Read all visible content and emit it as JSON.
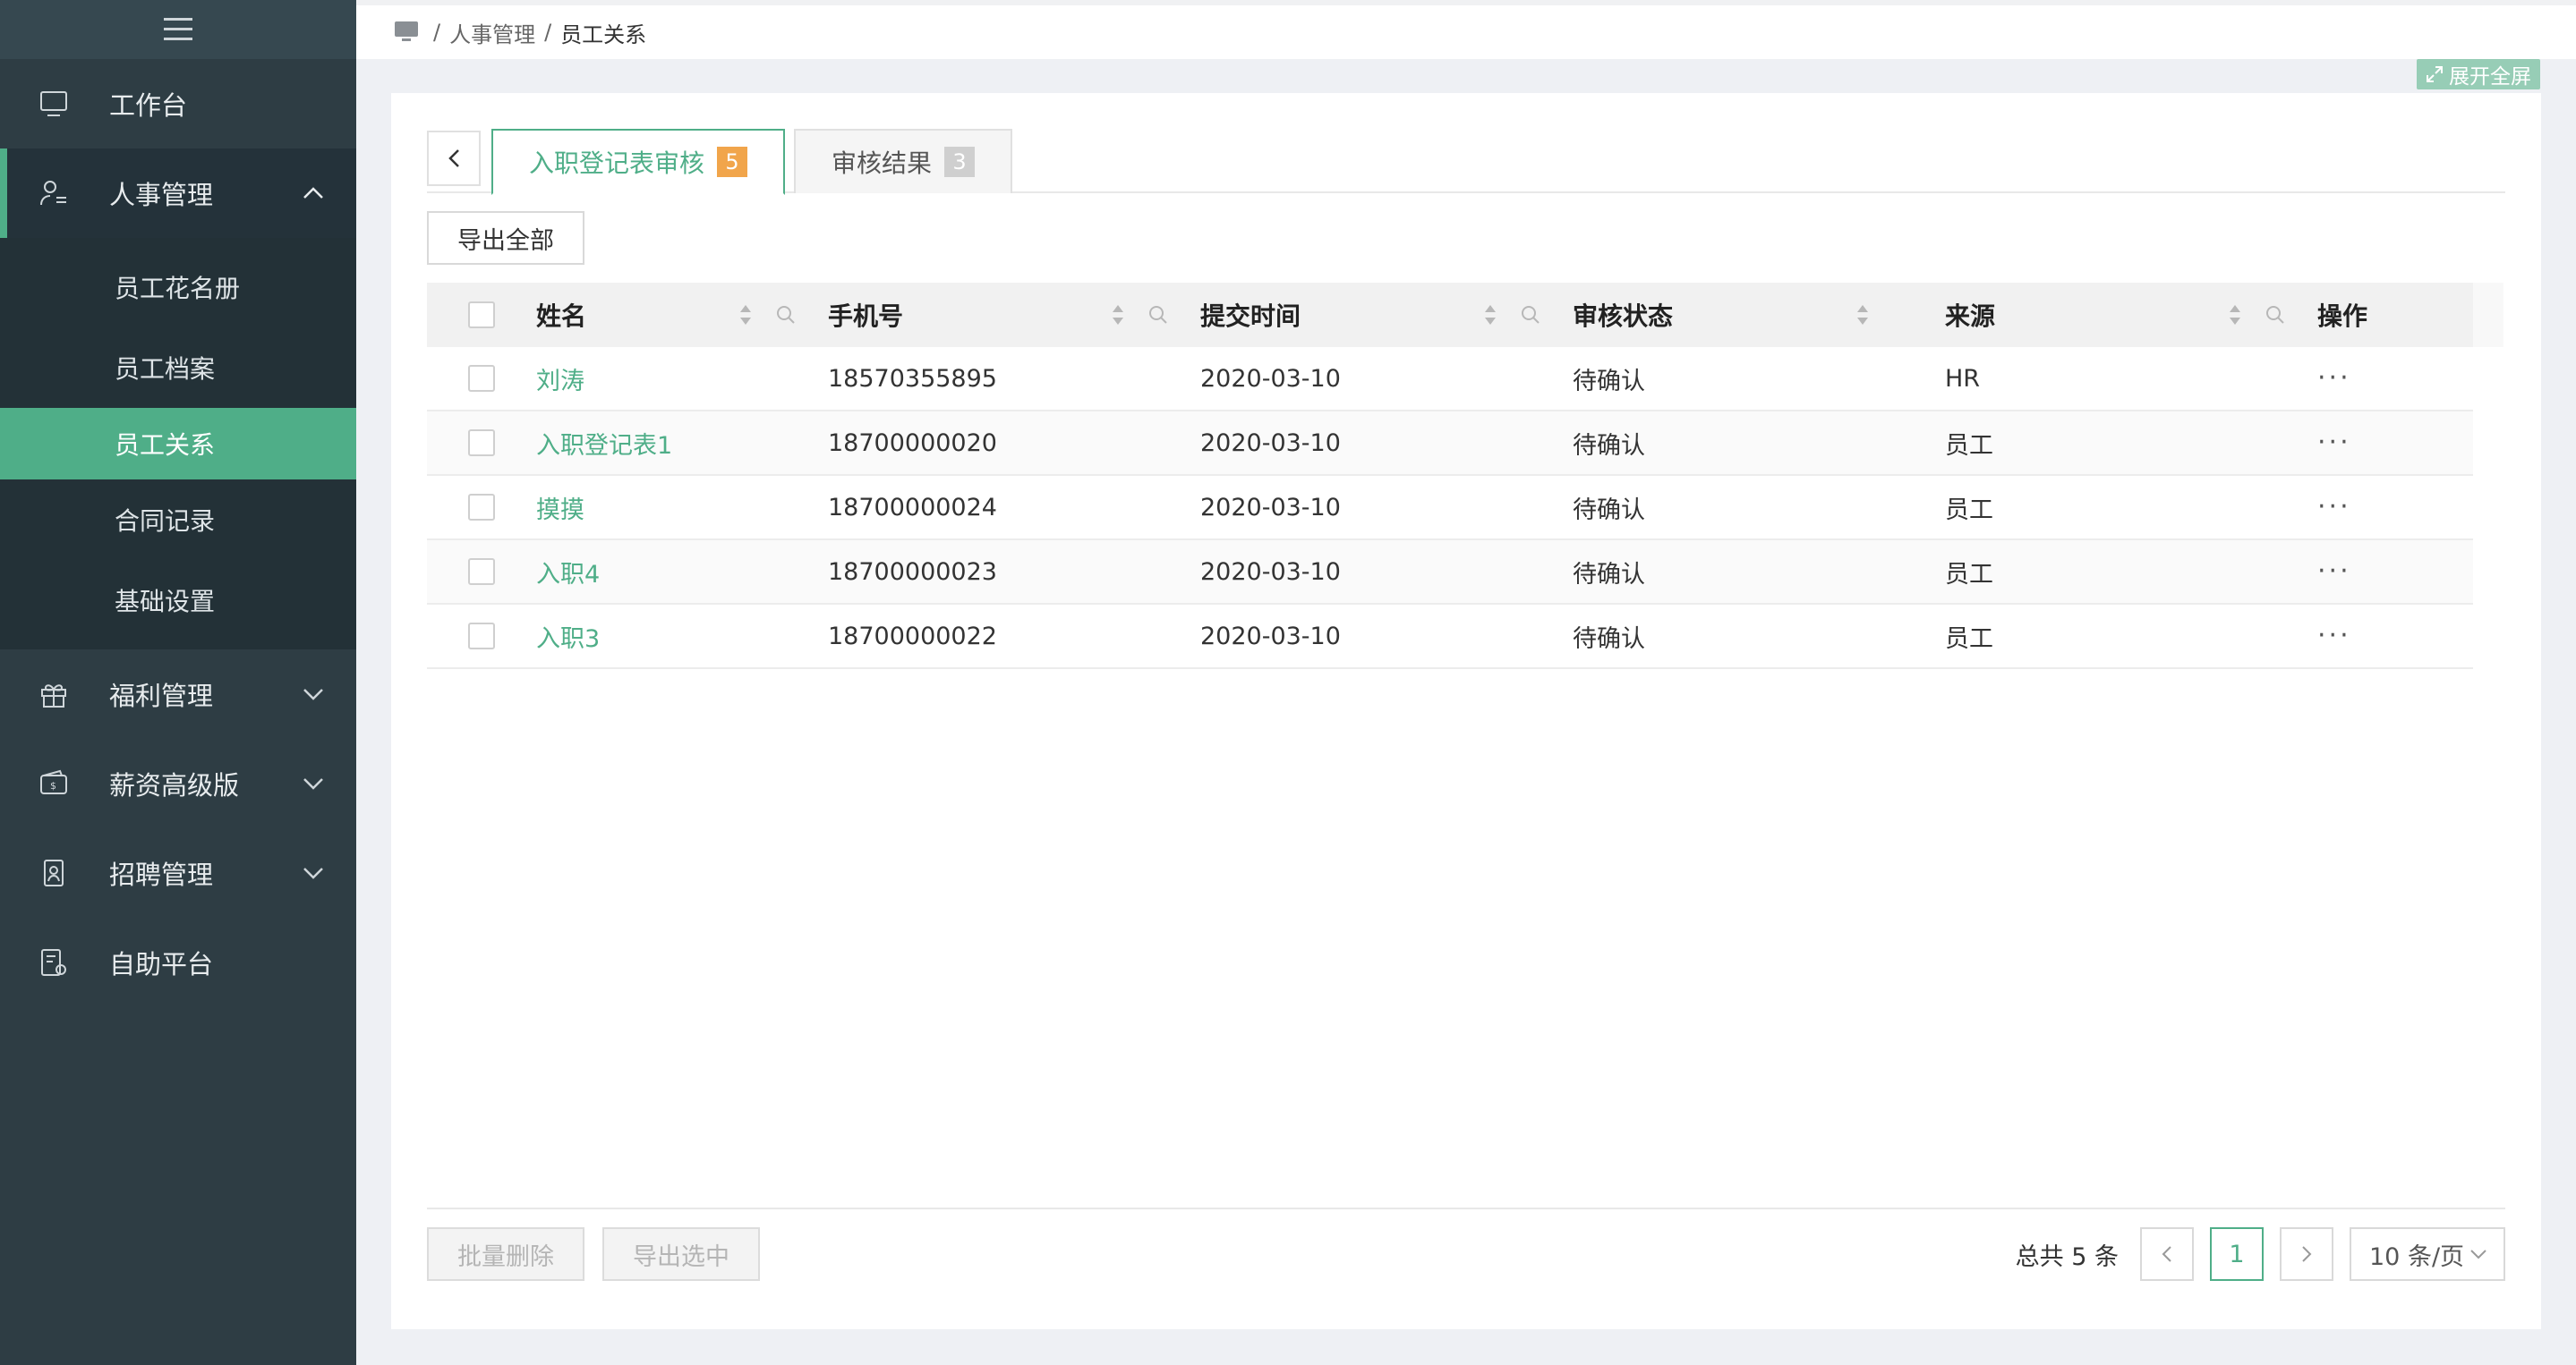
{
  "sidebar": {
    "items": [
      {
        "label": "工作台",
        "icon": "monitor-icon"
      },
      {
        "label": "人事管理",
        "icon": "user-list-icon",
        "expanded": true,
        "children": [
          "员工花名册",
          "员工档案",
          "员工关系",
          "合同记录",
          "基础设置"
        ],
        "active_child": "员工关系"
      },
      {
        "label": "福利管理",
        "icon": "gift-icon"
      },
      {
        "label": "薪资高级版",
        "icon": "wallet-icon"
      },
      {
        "label": "招聘管理",
        "icon": "badge-icon"
      },
      {
        "label": "自助平台",
        "icon": "self-service-icon"
      }
    ]
  },
  "breadcrumb": {
    "sep": "/",
    "items": [
      "人事管理",
      "员工关系"
    ]
  },
  "fullscreen_label": "展开全屏",
  "tabs": [
    {
      "label": "入职登记表审核",
      "badge": "5",
      "active": true
    },
    {
      "label": "审核结果",
      "badge": "3",
      "active": false
    }
  ],
  "export_all_label": "导出全部",
  "table": {
    "columns": [
      "姓名",
      "手机号",
      "提交时间",
      "审核状态",
      "来源",
      "操作"
    ],
    "rows": [
      {
        "name": "刘涛",
        "phone": "18570355895",
        "time": "2020-03-10",
        "status": "待确认",
        "source": "HR",
        "op": "···"
      },
      {
        "name": "入职登记表1",
        "phone": "18700000020",
        "time": "2020-03-10",
        "status": "待确认",
        "source": "员工",
        "op": "···"
      },
      {
        "name": "摸摸",
        "phone": "18700000024",
        "time": "2020-03-10",
        "status": "待确认",
        "source": "员工",
        "op": "···"
      },
      {
        "name": "入职4",
        "phone": "18700000023",
        "time": "2020-03-10",
        "status": "待确认",
        "source": "员工",
        "op": "···"
      },
      {
        "name": "入职3",
        "phone": "18700000022",
        "time": "2020-03-10",
        "status": "待确认",
        "source": "员工",
        "op": "···"
      }
    ]
  },
  "footer": {
    "batch_delete_label": "批量删除",
    "export_selected_label": "导出选中",
    "total_text": "总共 5 条",
    "current_page": "1",
    "page_size_label": "10 条/页"
  },
  "colors": {
    "accent": "#4fae88",
    "sidebar": "#2e3d44",
    "badge_orange": "#f1a54b"
  }
}
